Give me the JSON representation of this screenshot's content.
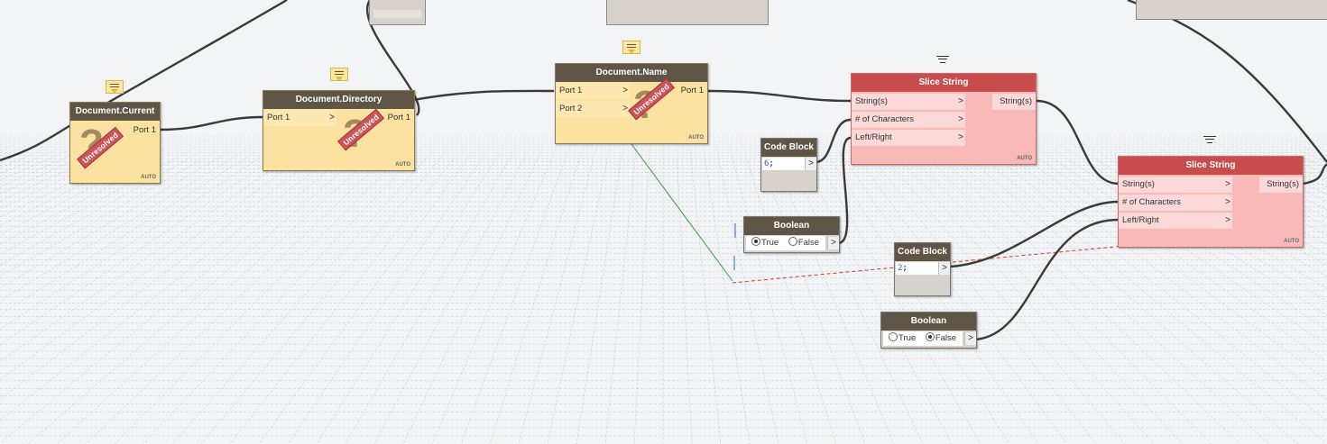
{
  "nodes": {
    "document_current": {
      "title": "Document.Current",
      "out": "Port 1",
      "status": "Unresolved",
      "lacing": "AUTO"
    },
    "document_directory": {
      "title": "Document.Directory",
      "in": "Port 1",
      "out": "Port 1",
      "status": "Unresolved",
      "lacing": "AUTO"
    },
    "document_name": {
      "title": "Document.Name",
      "in1": "Port 1",
      "in2": "Port 2",
      "out": "Port 1",
      "status": "Unresolved",
      "lacing": "AUTO"
    },
    "slice_string_1": {
      "title": "Slice String",
      "in1": "String(s)",
      "in2": "# of Characters",
      "in3": "Left/Right",
      "out": "String(s)",
      "lacing": "AUTO"
    },
    "slice_string_2": {
      "title": "Slice String",
      "in1": "String(s)",
      "in2": "# of Characters",
      "in3": "Left/Right",
      "out": "String(s)",
      "lacing": "AUTO"
    },
    "code_block_1": {
      "title": "Code Block",
      "value": "6",
      "semicolon": ";",
      "out": ">"
    },
    "code_block_2": {
      "title": "Code Block",
      "value": "2",
      "semicolon": ";",
      "out": ">"
    },
    "boolean_1": {
      "title": "Boolean",
      "true_label": "True",
      "false_label": "False",
      "selected": "True",
      "out": ">"
    },
    "boolean_2": {
      "title": "Boolean",
      "true_label": "True",
      "false_label": "False",
      "selected": "False",
      "out": ">"
    }
  },
  "colors": {
    "header": "#5e5547",
    "unresolved_body": "#fbe2a0",
    "slice_header": "#c94c4c",
    "slice_body": "#f9b9b9",
    "wire": "#3a3a3a",
    "grid": "#9fb6c9"
  },
  "icons": [
    "note-icon",
    "pin-icon",
    "question-mark-icon",
    "chevron-right-icon",
    "radio-icon"
  ]
}
